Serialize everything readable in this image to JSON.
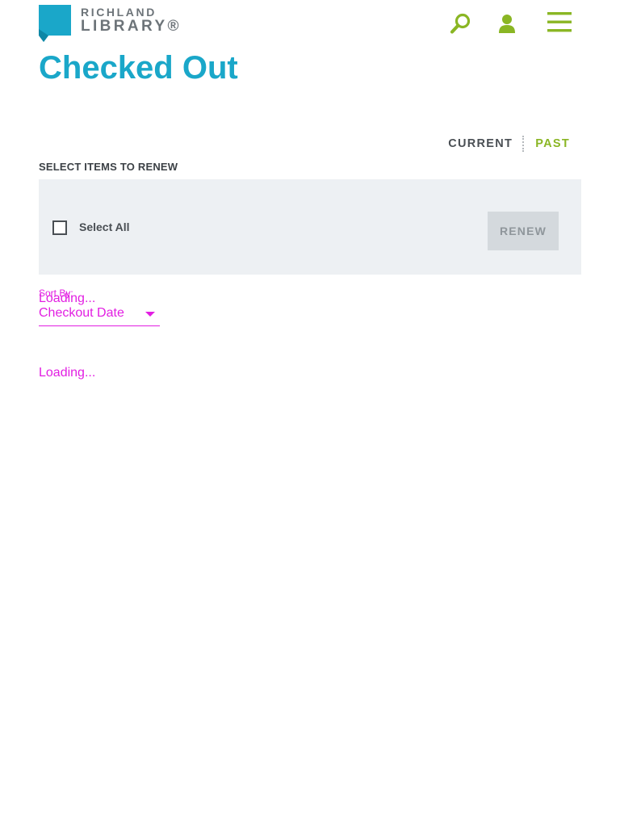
{
  "header": {
    "logo": {
      "line1": "RICHLAND",
      "line2": "LIBRARY®",
      "icon": "richland-library-logo",
      "brand_color": "#1aa7c9"
    },
    "icons": {
      "search": "search-icon",
      "account": "account-icon",
      "menu": "hamburger-menu-icon"
    },
    "icon_color": "#8ab624"
  },
  "page": {
    "title": "Checked Out",
    "title_color": "#1aa7c9"
  },
  "toggle": {
    "current_label": "CURRENT",
    "past_label": "PAST",
    "active": "PAST"
  },
  "renew": {
    "section_label": "SELECT ITEMS TO RENEW",
    "select_all_label": "Select All",
    "select_all_checked": false,
    "button_label": "RENEW",
    "button_disabled": true
  },
  "sort": {
    "label": "Sort By:",
    "loading_text": "Loading...",
    "selected_value": "Checkout Date"
  },
  "list": {
    "loading_text": "Loading..."
  },
  "colors": {
    "accent_green": "#8ab624",
    "panel_bg": "#edf0f3",
    "debug_magenta": "#e21ee2"
  }
}
